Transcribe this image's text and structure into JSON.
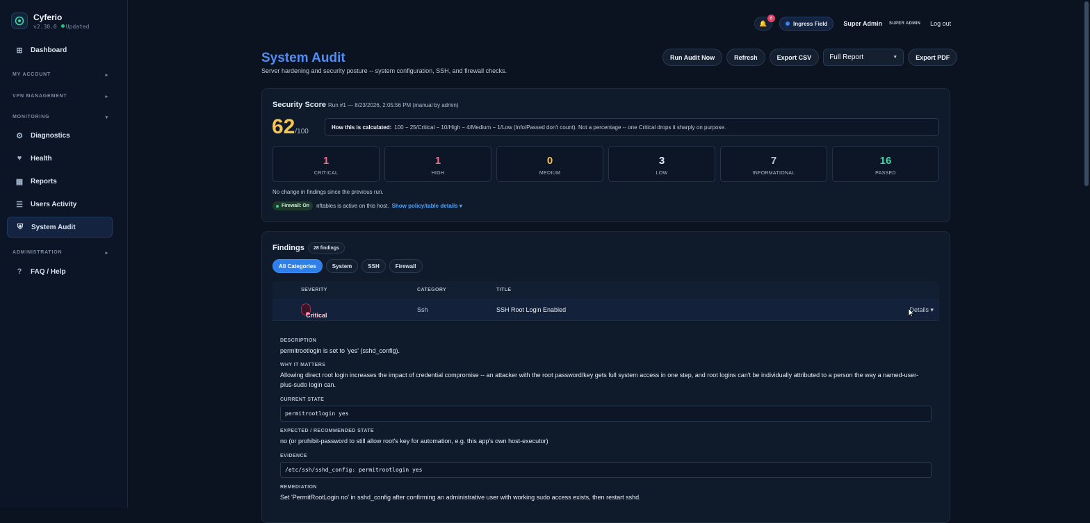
{
  "app": {
    "name": "Cyferio",
    "version": "v2.30.0",
    "status": "Updated"
  },
  "sidebar": {
    "items": [
      {
        "label": "Dashboard",
        "icon": "grid-icon"
      },
      {
        "label": "Diagnostics",
        "icon": "gear-icon"
      },
      {
        "label": "Health",
        "icon": "heart-icon"
      },
      {
        "label": "Reports",
        "icon": "table-icon"
      },
      {
        "label": "Users Activity",
        "icon": "list-icon"
      },
      {
        "label": "System Audit",
        "icon": "shield-icon",
        "active": true
      },
      {
        "label": "FAQ / Help",
        "icon": "question-icon"
      }
    ],
    "sections": [
      "MY ACCOUNT",
      "VPN MANAGEMENT",
      "MONITORING",
      "ADMINISTRATION"
    ]
  },
  "topbar": {
    "notifications": "6",
    "field": "Ingress Field",
    "user": "Super Admin",
    "role": "SUPER ADMIN",
    "logout": "Log out"
  },
  "page": {
    "title": "System Audit",
    "subtitle": "Server hardening and security posture -- system configuration, SSH, and firewall checks."
  },
  "actions": {
    "run": "Run Audit Now",
    "refresh": "Refresh",
    "export_csv": "Export CSV",
    "report_type": "Full Report",
    "export_pdf": "Export PDF"
  },
  "score": {
    "title": "Security Score",
    "run": "Run #1 — 8/23/2026, 2:05:56 PM (manual by admin)",
    "value": "62",
    "max": "/100",
    "how_label": "How this is calculated:",
    "how_text": "100 − 25/Critical − 10/High − 4/Medium − 1/Low (Info/Passed don't count). Not a percentage -- one Critical drops it sharply on purpose.",
    "stats": [
      {
        "num": "1",
        "label": "CRITICAL",
        "color": "#f06a8b"
      },
      {
        "num": "1",
        "label": "HIGH",
        "color": "#f06a8b"
      },
      {
        "num": "0",
        "label": "MEDIUM",
        "color": "#f5c453"
      },
      {
        "num": "3",
        "label": "LOW",
        "color": "#e6edf6"
      },
      {
        "num": "7",
        "label": "INFORMATIONAL",
        "color": "#b7c2d3"
      },
      {
        "num": "16",
        "label": "PASSED",
        "color": "#3fd9a8"
      }
    ],
    "no_change": "No change in findings since the previous run.",
    "firewall_badge": "Firewall: On",
    "firewall_text": "nftables is active on this host.",
    "firewall_link": "Show policy/table details ▾"
  },
  "findings": {
    "title": "Findings",
    "count": "28 findings",
    "tabs": [
      "All Categories",
      "System",
      "SSH",
      "Firewall"
    ],
    "columns": [
      "SEVERITY",
      "CATEGORY",
      "TITLE"
    ],
    "row": {
      "severity": "Critical",
      "category": "Ssh",
      "title": "SSH Root Login Enabled",
      "details": "Details ▾"
    },
    "detail": {
      "description_label": "DESCRIPTION",
      "description": "permitrootlogin is set to 'yes' (sshd_config).",
      "why_label": "WHY IT MATTERS",
      "why": "Allowing direct root login increases the impact of credential compromise -- an attacker with the root password/key gets full system access in one step, and root logins can't be individually attributed to a person the way a named-user-plus-sudo login can.",
      "current_label": "CURRENT STATE",
      "current": "permitrootlogin yes",
      "expected_label": "EXPECTED / RECOMMENDED STATE",
      "expected": "no (or prohibit-password to still allow root's key for automation, e.g. this app's own host-executor)",
      "evidence_label": "EVIDENCE",
      "evidence": "/etc/ssh/sshd_config: permitrootlogin yes",
      "remediation_label": "REMEDIATION",
      "remediation": "Set 'PermitRootLogin no' in sshd_config after confirming an administrative user with working sudo access exists, then restart sshd."
    }
  }
}
